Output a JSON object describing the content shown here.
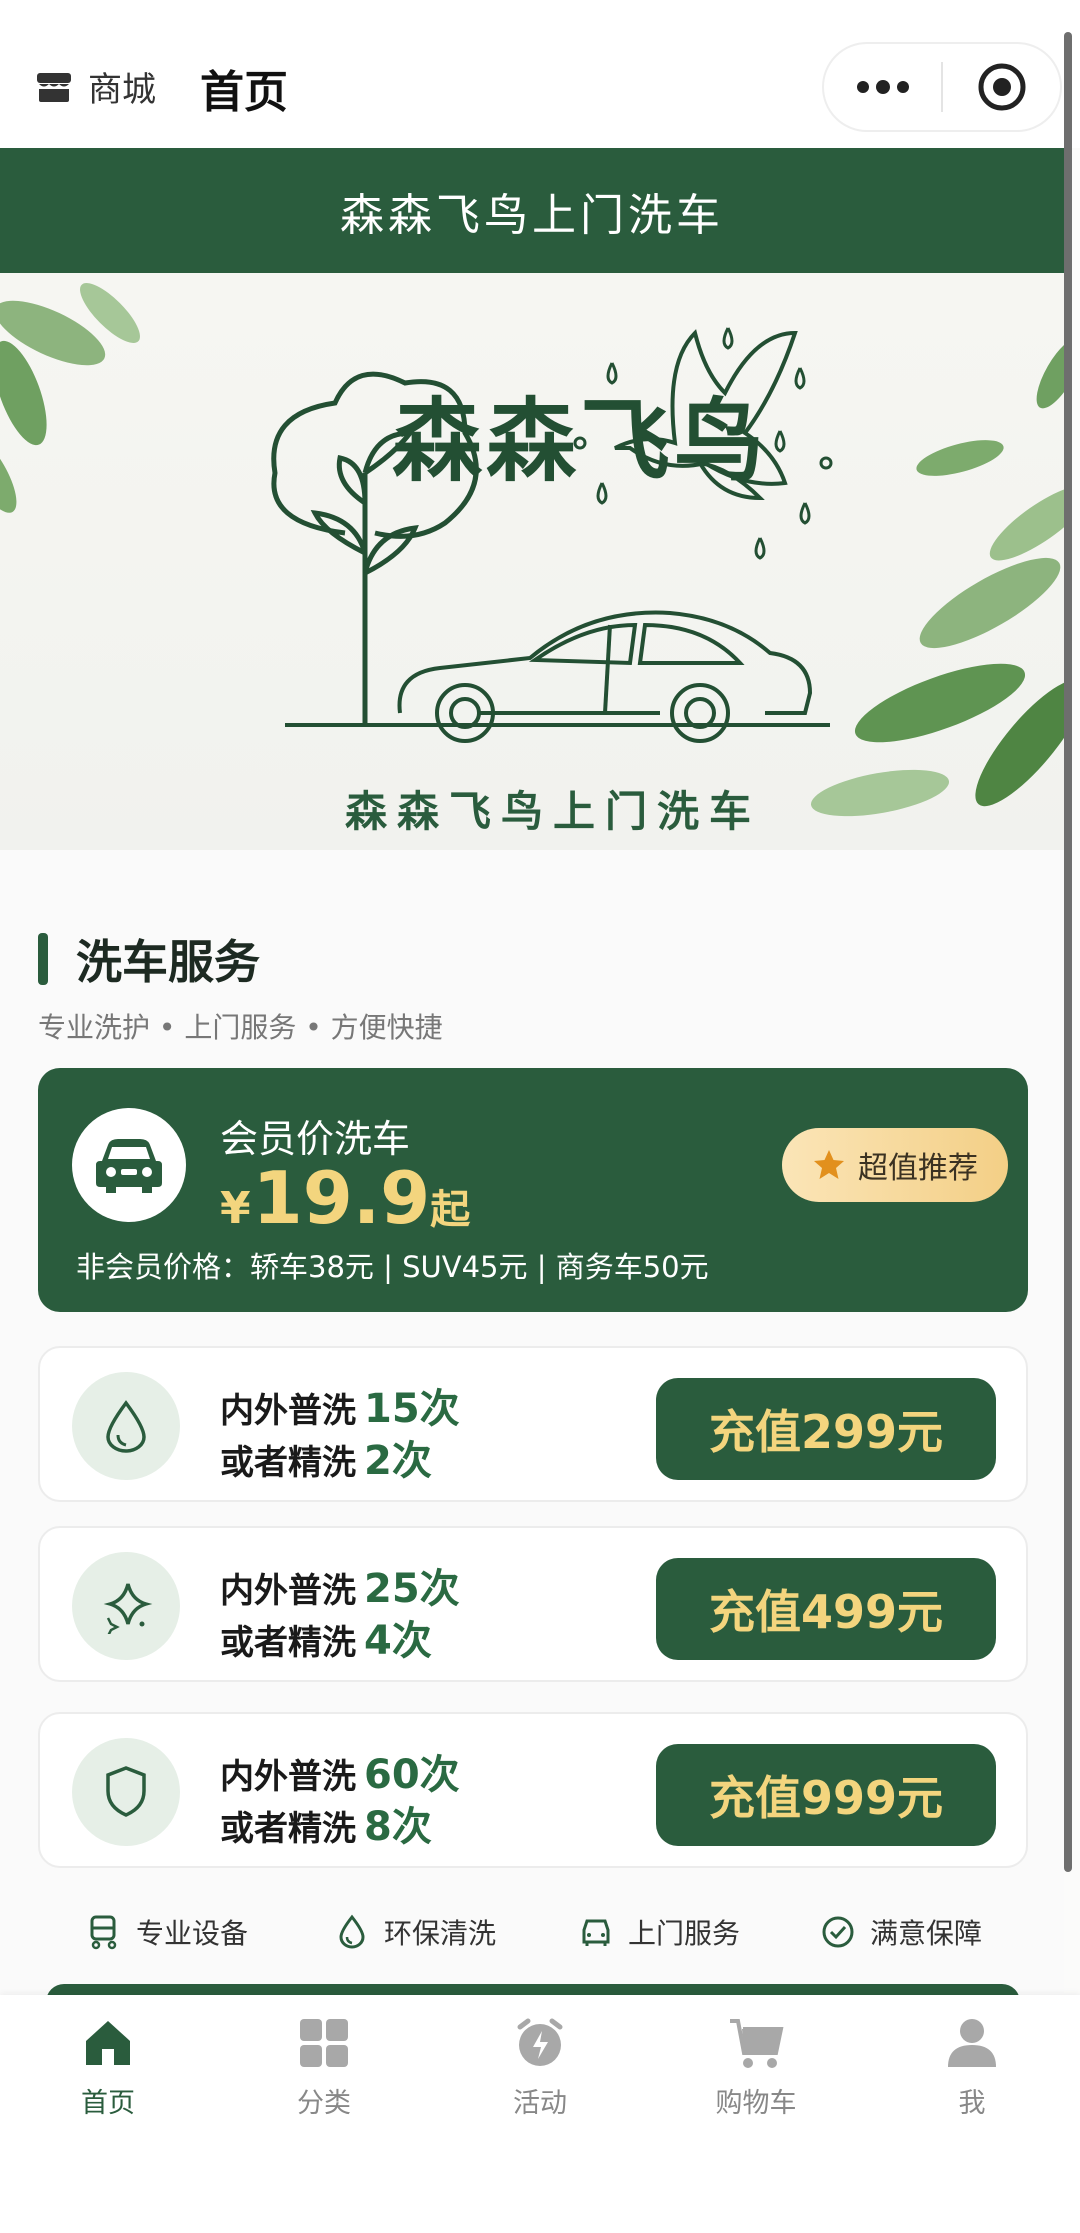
{
  "topnav": {
    "shop_label": "商城",
    "title": "首页"
  },
  "banner": {
    "brand_bar": "森森飞鸟上门洗车",
    "hero_title": "森森飞鸟",
    "hero_subtitle": "森森飞鸟上门洗车"
  },
  "section": {
    "title": "洗车服务",
    "subtitle": "专业洗护 • 上门服务 • 方便快捷"
  },
  "member_card": {
    "title": "会员价洗车",
    "currency": "¥",
    "price": "19.9",
    "suffix": "起",
    "badge": "超值推荐",
    "note": "非会员价格：轿车38元 | SUV45元 | 商务车50元"
  },
  "plans": [
    {
      "icon": "water-drop-icon",
      "line1_label": "内外普洗",
      "line1_count": "15次",
      "line2_label": "或者精洗",
      "line2_count": "2次",
      "button": "充值299元"
    },
    {
      "icon": "sparkle-icon",
      "line1_label": "内外普洗",
      "line1_count": "25次",
      "line2_label": "或者精洗",
      "line2_count": "4次",
      "button": "充值499元"
    },
    {
      "icon": "shield-icon",
      "line1_label": "内外普洗",
      "line1_count": "60次",
      "line2_label": "或者精洗",
      "line2_count": "8次",
      "button": "充值999元"
    }
  ],
  "features": [
    {
      "icon": "equipment-icon",
      "label": "专业设备"
    },
    {
      "icon": "water-drop-icon",
      "label": "环保清洗"
    },
    {
      "icon": "car-icon",
      "label": "上门服务"
    },
    {
      "icon": "check-circle-icon",
      "label": "满意保障"
    }
  ],
  "tabbar": [
    {
      "icon": "home-icon",
      "label": "首页",
      "active": true
    },
    {
      "icon": "category-icon",
      "label": "分类",
      "active": false
    },
    {
      "icon": "alarm-clock-icon",
      "label": "活动",
      "active": false
    },
    {
      "icon": "cart-icon",
      "label": "购物车",
      "active": false
    },
    {
      "icon": "user-icon",
      "label": "我",
      "active": false
    }
  ],
  "colors": {
    "primary": "#2a5c3d",
    "gold": "#f3d57e",
    "icon_bg": "#e6efe7"
  }
}
